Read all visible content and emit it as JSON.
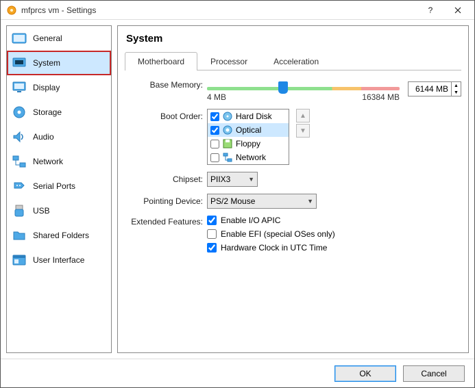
{
  "window": {
    "title": "mfprcs vm - Settings"
  },
  "sidebar": {
    "items": [
      {
        "label": "General"
      },
      {
        "label": "System"
      },
      {
        "label": "Display"
      },
      {
        "label": "Storage"
      },
      {
        "label": "Audio"
      },
      {
        "label": "Network"
      },
      {
        "label": "Serial Ports"
      },
      {
        "label": "USB"
      },
      {
        "label": "Shared Folders"
      },
      {
        "label": "User Interface"
      }
    ]
  },
  "page": {
    "heading": "System",
    "tabs": [
      {
        "label": "Motherboard"
      },
      {
        "label": "Processor"
      },
      {
        "label": "Acceleration"
      }
    ],
    "base_memory": {
      "label": "Base Memory:",
      "min_label": "4 MB",
      "max_label": "16384 MB",
      "value": "6144 MB"
    },
    "boot_order": {
      "label": "Boot Order:",
      "items": [
        {
          "label": "Hard Disk",
          "checked": true
        },
        {
          "label": "Optical",
          "checked": true,
          "selected": true
        },
        {
          "label": "Floppy",
          "checked": false
        },
        {
          "label": "Network",
          "checked": false
        }
      ]
    },
    "chipset": {
      "label": "Chipset:",
      "value": "PIIX3"
    },
    "pointing": {
      "label": "Pointing Device:",
      "value": "PS/2 Mouse"
    },
    "extended": {
      "label": "Extended Features:",
      "opts": [
        {
          "label": "Enable I/O APIC",
          "checked": true
        },
        {
          "label": "Enable EFI (special OSes only)",
          "checked": false
        },
        {
          "label": "Hardware Clock in UTC Time",
          "checked": true
        }
      ]
    }
  },
  "footer": {
    "ok": "OK",
    "cancel": "Cancel"
  },
  "colors": {
    "accent": "#1e88e5",
    "highlight": "#c62828"
  }
}
